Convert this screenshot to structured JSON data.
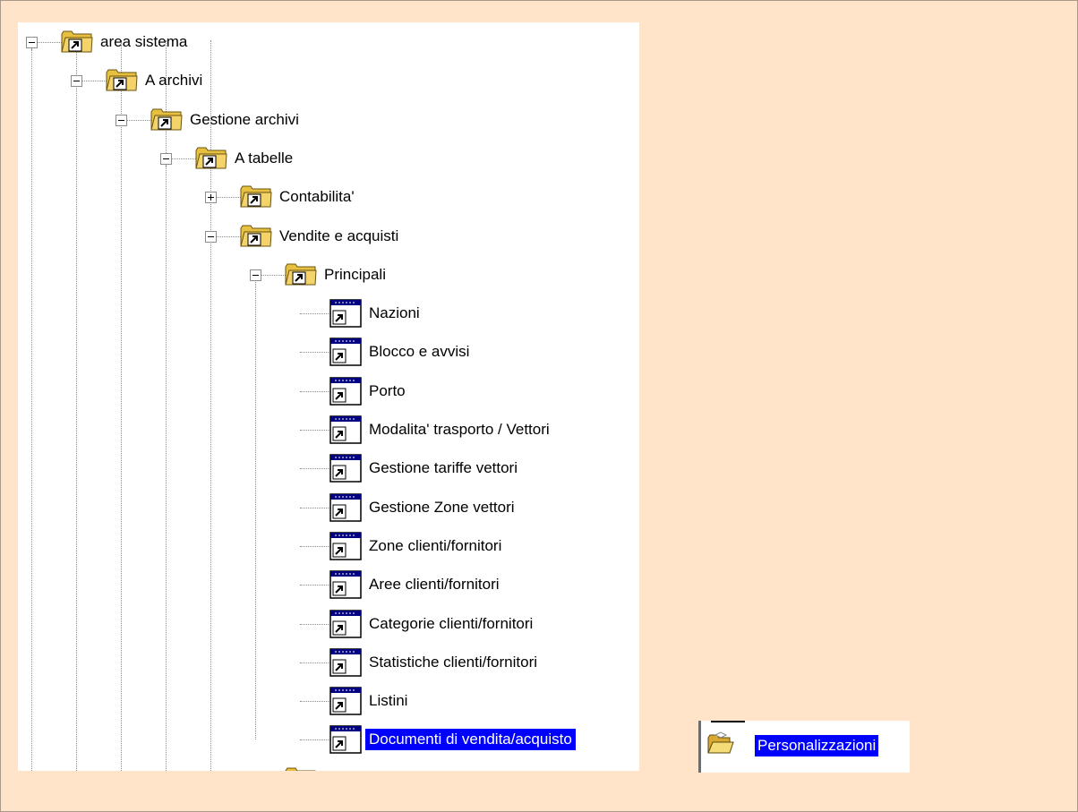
{
  "tree": {
    "nodes": [
      {
        "label": "area sistema",
        "level": 0,
        "icon": "folder-shortcut-icon",
        "expander": "minus"
      },
      {
        "label": "A archivi",
        "level": 1,
        "icon": "folder-shortcut-icon",
        "expander": "minus"
      },
      {
        "label": "Gestione archivi",
        "level": 2,
        "icon": "folder-shortcut-icon",
        "expander": "minus"
      },
      {
        "label": "A tabelle",
        "level": 3,
        "icon": "folder-shortcut-icon",
        "expander": "minus"
      },
      {
        "label": "Contabilita'",
        "level": 4,
        "icon": "folder-shortcut-icon",
        "expander": "plus"
      },
      {
        "label": "Vendite e acquisti",
        "level": 4,
        "icon": "folder-shortcut-icon",
        "expander": "minus"
      },
      {
        "label": "Principali",
        "level": 5,
        "icon": "folder-shortcut-icon",
        "expander": "minus"
      },
      {
        "label": "Nazioni",
        "level": 6,
        "icon": "window-shortcut-icon",
        "expander": "none"
      },
      {
        "label": "Blocco e avvisi",
        "level": 6,
        "icon": "window-shortcut-icon",
        "expander": "none"
      },
      {
        "label": "Porto",
        "level": 6,
        "icon": "window-shortcut-icon",
        "expander": "none"
      },
      {
        "label": "Modalita' trasporto / Vettori",
        "level": 6,
        "icon": "window-shortcut-icon",
        "expander": "none"
      },
      {
        "label": "Gestione tariffe vettori",
        "level": 6,
        "icon": "window-shortcut-icon",
        "expander": "none"
      },
      {
        "label": "Gestione Zone vettori",
        "level": 6,
        "icon": "window-shortcut-icon",
        "expander": "none"
      },
      {
        "label": "Zone clienti/fornitori",
        "level": 6,
        "icon": "window-shortcut-icon",
        "expander": "none"
      },
      {
        "label": "Aree clienti/fornitori",
        "level": 6,
        "icon": "window-shortcut-icon",
        "expander": "none"
      },
      {
        "label": "Categorie clienti/fornitori",
        "level": 6,
        "icon": "window-shortcut-icon",
        "expander": "none"
      },
      {
        "label": "Statistiche clienti/fornitori",
        "level": 6,
        "icon": "window-shortcut-icon",
        "expander": "none"
      },
      {
        "label": "Listini",
        "level": 6,
        "icon": "window-shortcut-icon",
        "expander": "none"
      },
      {
        "label": "Documenti di vendita/acquisto",
        "level": 6,
        "icon": "window-shortcut-icon",
        "expander": "none",
        "selected": true
      }
    ]
  },
  "side_panel": {
    "label": "Personalizzazioni",
    "icon": "open-folder-icon",
    "selected": true
  },
  "colors": {
    "background": "#ffe4c9",
    "selection": "#0000ff",
    "folder": "#e8c040"
  }
}
